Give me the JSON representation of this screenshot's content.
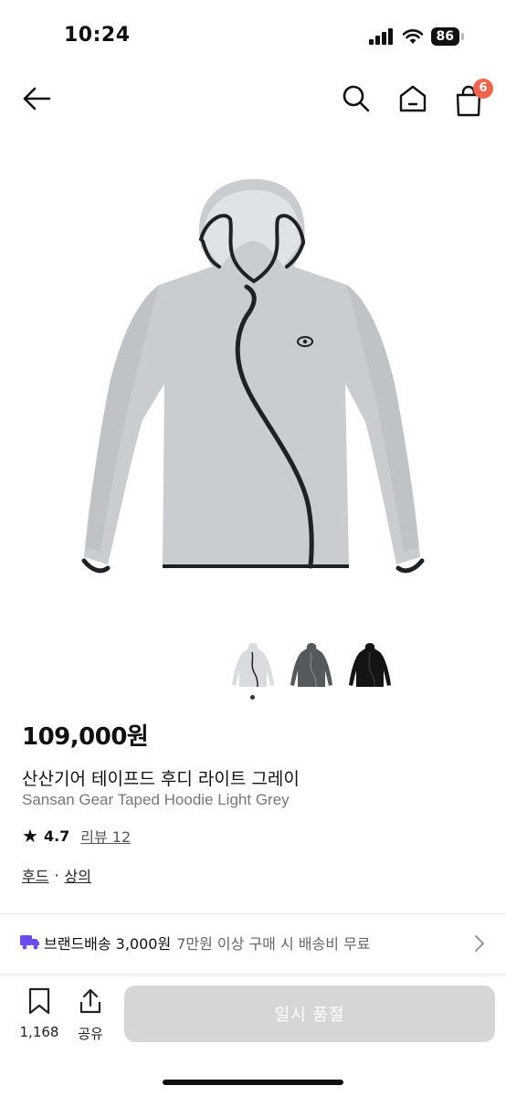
{
  "status_bar": {
    "time": "10:24",
    "battery": "86"
  },
  "nav": {
    "cart_count": "6"
  },
  "gallery": {
    "thumbnail_colors": [
      "#d8dcdf",
      "#55595c",
      "#141414"
    ],
    "selected_index": 0
  },
  "product": {
    "price": "109,000원",
    "name_ko": "산산기어 테이프드 후디 라이트 그레이",
    "name_en": "Sansan Gear Taped Hoodie Light Grey",
    "rating": "4.7",
    "review_label": "리뷰 12",
    "categories": [
      "후드",
      "상의"
    ],
    "category_separator": "·"
  },
  "shipping": {
    "brand_label": "브랜드배송 3,000원",
    "condition": "7만원 이상 구매 시 배송비 무료"
  },
  "bottom_bar": {
    "save_count": "1,168",
    "share_label": "공유",
    "soldout_label": "일시 품절"
  },
  "colors": {
    "accent_badge": "#f0644e",
    "hoodie_body": "#c9cdd0",
    "trim": "#1e2227",
    "truck": "#6c4cf0",
    "disabled_button": "#d6d6d6"
  }
}
